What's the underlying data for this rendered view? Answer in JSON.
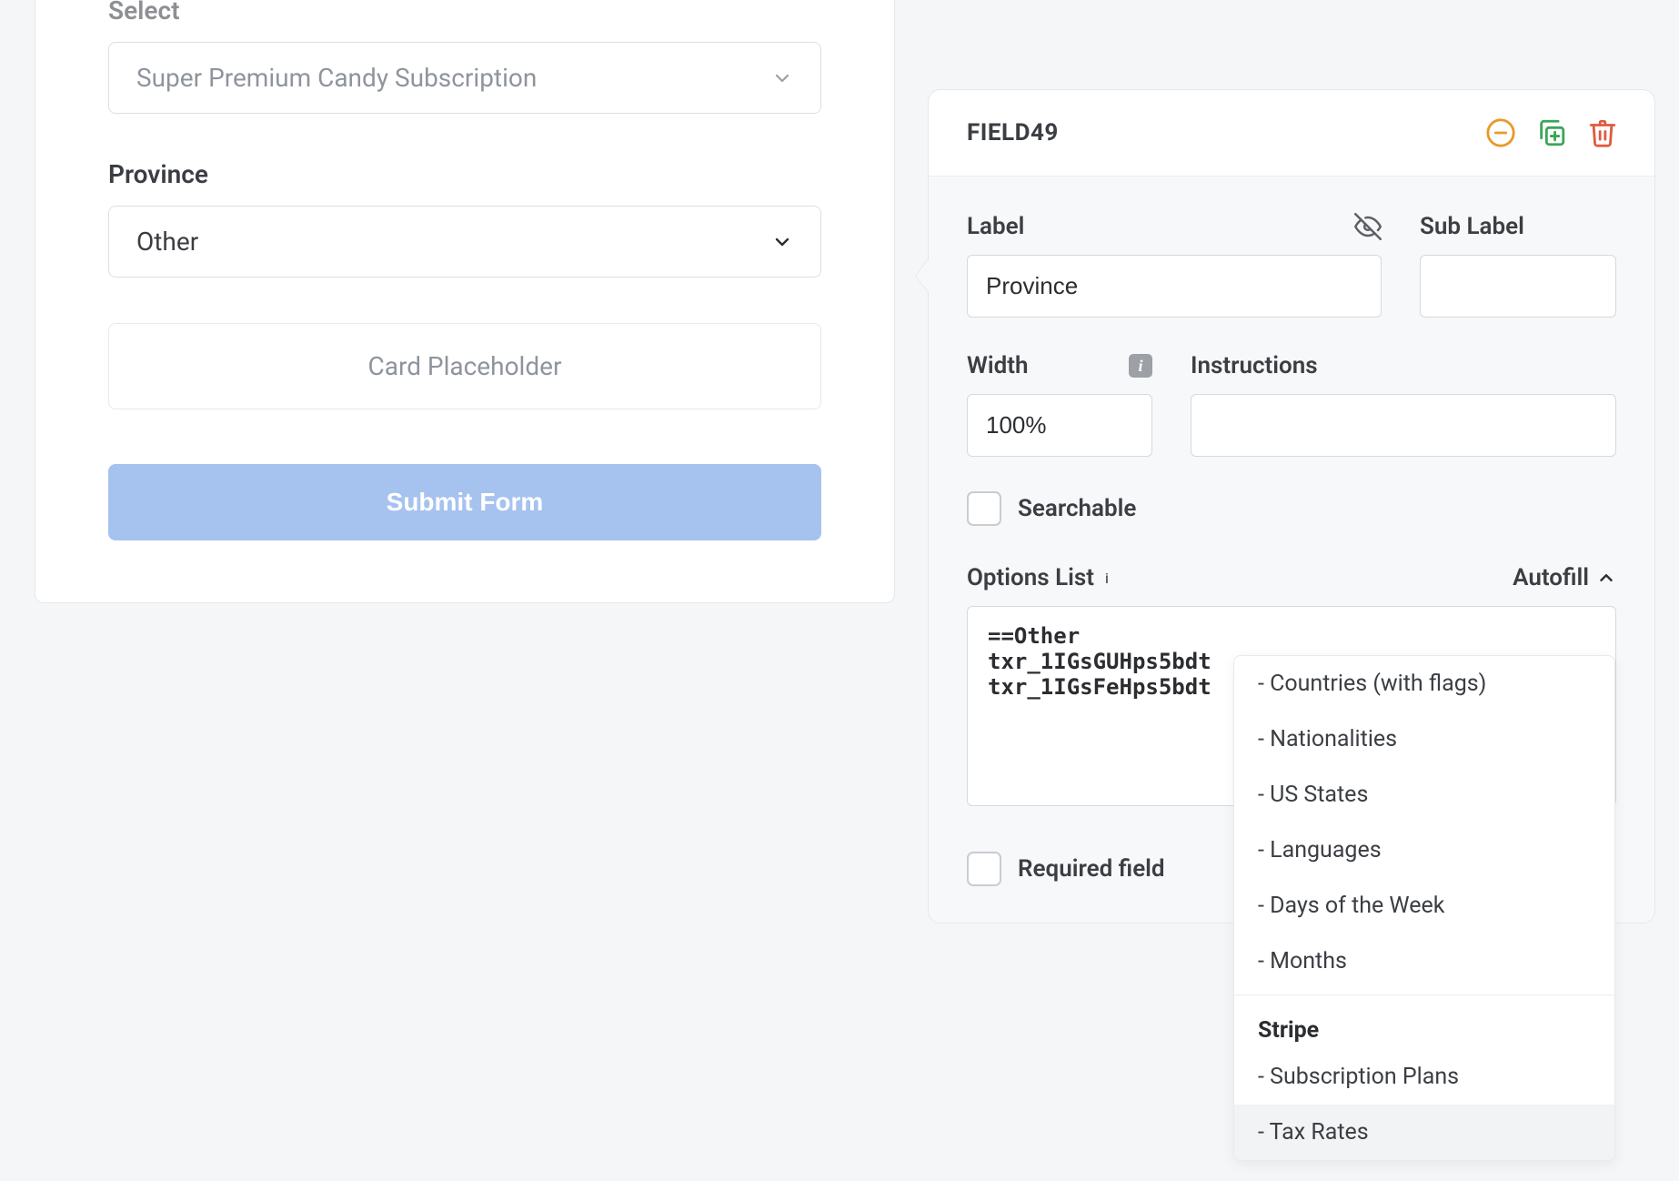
{
  "form": {
    "select": {
      "label": "Select",
      "value": "Super Premium Candy Subscription"
    },
    "province": {
      "label": "Province",
      "value": "Other"
    },
    "card_placeholder": "Card Placeholder",
    "submit_label": "Submit Form"
  },
  "panel": {
    "title": "FIELD49",
    "label": {
      "title": "Label",
      "value": "Province"
    },
    "sub_label": {
      "title": "Sub Label",
      "value": ""
    },
    "width": {
      "title": "Width",
      "value": "100%"
    },
    "instructions": {
      "title": "Instructions",
      "value": ""
    },
    "searchable": {
      "label": "Searchable"
    },
    "options_list": {
      "title": "Options List",
      "autofill_label": "Autofill",
      "value": "==Other\ntxr_1IGsGUHps5bdt\ntxr_1IGsFeHps5bdt"
    },
    "required": {
      "label": "Required field"
    }
  },
  "dropdown": {
    "items": [
      "Countries (with flags)",
      "Nationalities",
      "US States",
      "Languages",
      "Days of the Week",
      "Months"
    ],
    "stripe_title": "Stripe",
    "stripe_items": [
      "Subscription Plans",
      "Tax Rates"
    ]
  }
}
